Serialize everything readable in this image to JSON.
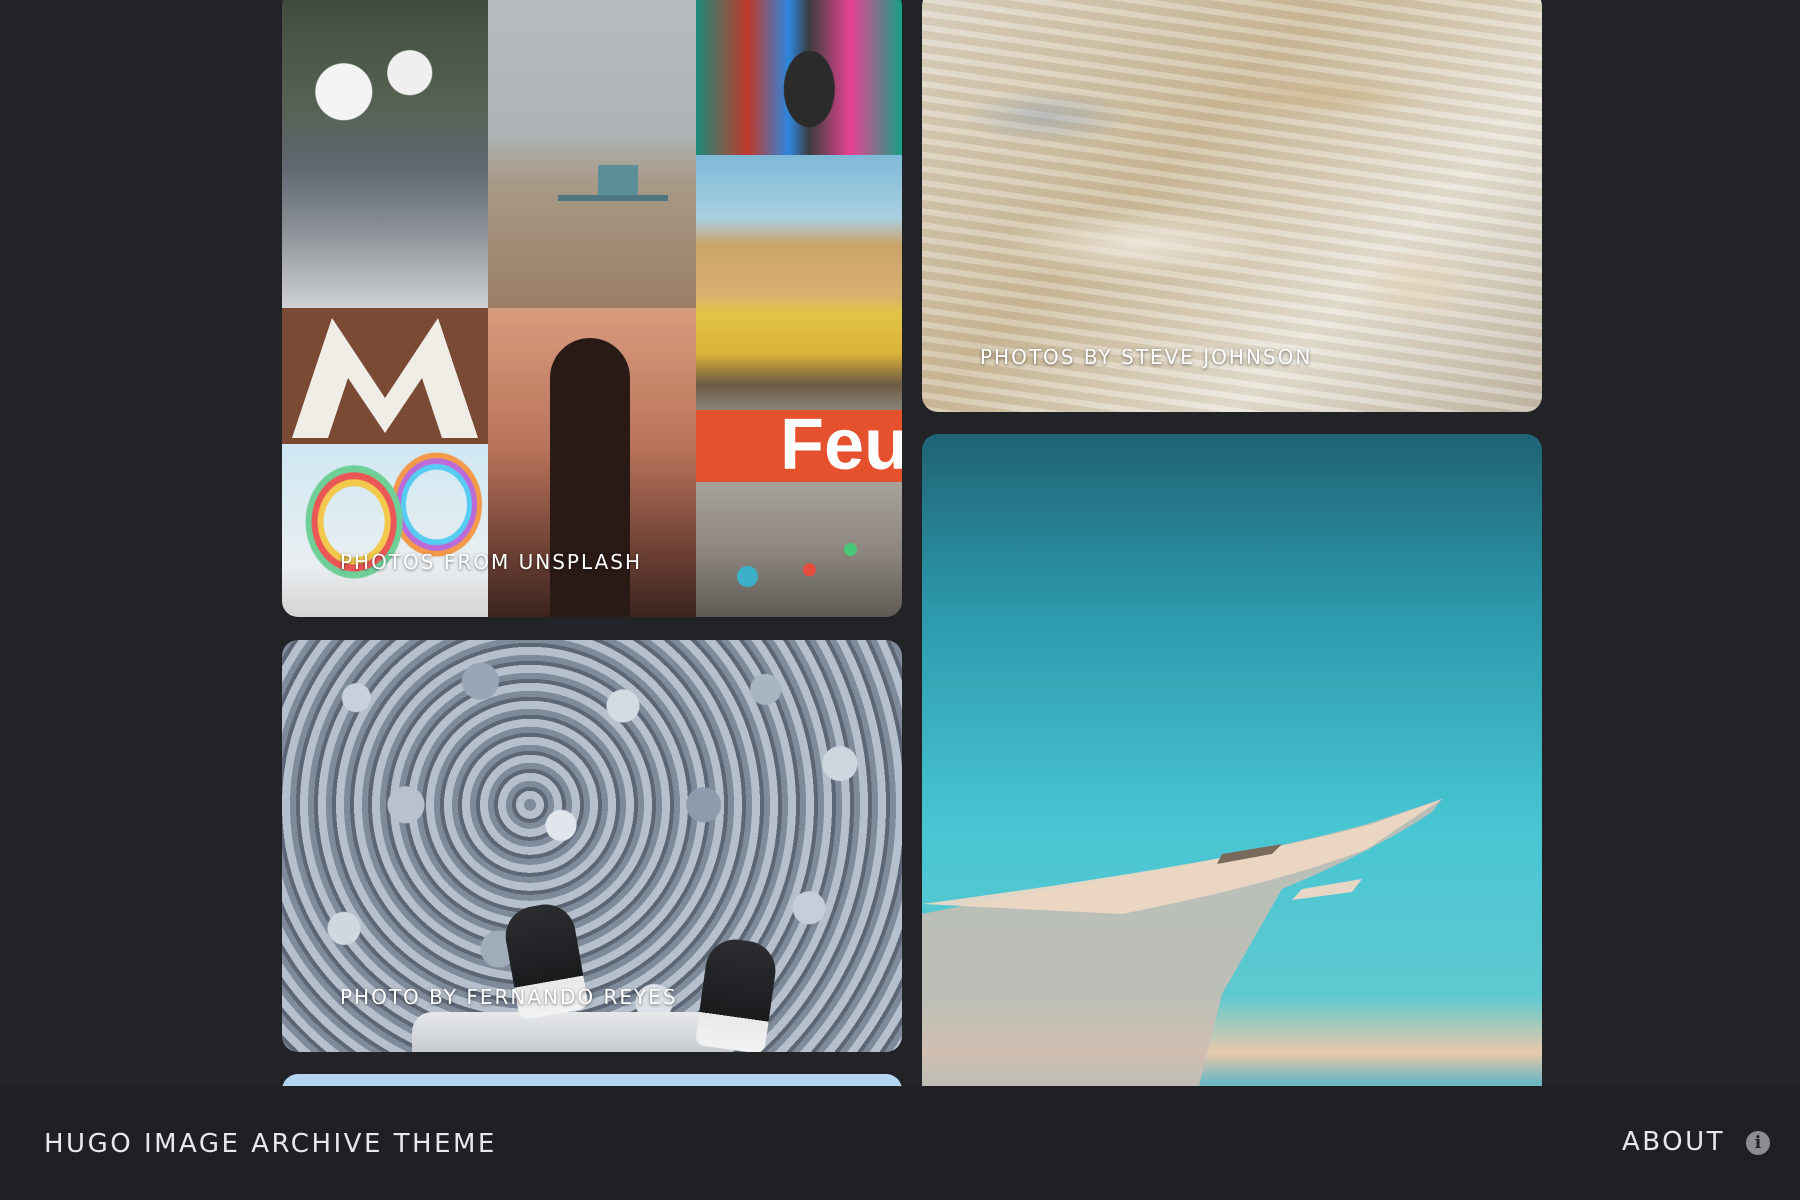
{
  "gallery": {
    "cards": [
      {
        "caption": "PHOTOS FROM UNSPLASH"
      },
      {
        "caption": "PHOTOS BY STEVE JOHNSON"
      },
      {
        "caption": "PHOTO BY FERNANDO REYES"
      },
      {
        "caption": ""
      },
      {
        "caption": ""
      }
    ],
    "collage_sign_text": "Feu"
  },
  "footer": {
    "site_title": "HUGO IMAGE ARCHIVE THEME",
    "about_label": "ABOUT",
    "info_icon": "i"
  },
  "colors": {
    "background": "#212327",
    "footer_background": "#1e2024",
    "text": "#e8e8ea"
  }
}
